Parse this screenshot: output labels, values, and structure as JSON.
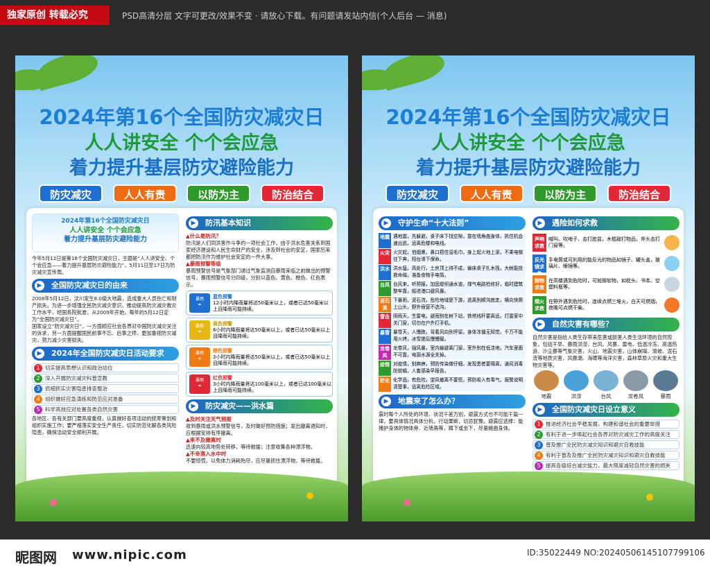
{
  "top": {
    "badge": "独家原创 转载必究",
    "note": "PSD高清分层 文字可更改/效果不变 · 请放心下载。有问题请发站内信(个人后台 — 消息)"
  },
  "bottom": {
    "logo": "昵图网",
    "url": "www.nipic.com",
    "id": "ID:35022449 NO:20240506145107799106"
  },
  "poster": {
    "title1": "2024年第16个全国防灾减灾日",
    "title2": "人人讲安全 个个会应急",
    "title3": "着力提升基层防灾避险能力",
    "tags": [
      "防灾减灾",
      "人人有责",
      "以防为主",
      "防治结合"
    ]
  },
  "left": {
    "banner": [
      "2024年第16个全国防灾减灾日",
      "人人讲安全 个个会应急",
      "着力提升基层防灾避险能力"
    ],
    "intro": "今年5月12日是第16个全国防灾减灾日，主题是“人人讲安全、个个会应急——着力提升基层防灾避险能力”，5月11日至17日为防灾减灾宣传周。",
    "sec1": "全国防灾减灾日的由来",
    "origin1": "2008年5月12日，汶川发生8.0级大地震，造成重大人员伤亡和财产损失。为进一步增强全民防灾减灾意识，推动提高防灾减灾救灾工作水平，经国务院批准，从2009年开始，每年的5月12日定为“全国防灾减灾日”。",
    "origin2": "国家设立“防灾减灾日”，一方面顺应社会各界对中国防灾减灾关注的诉求，另一方面提醒国民前事不忘、后事之师，更加重视防灾减灾，努力减少灾害损失。",
    "sec2": "2024年全国防灾减灾日活动要求",
    "reqs": [
      "切实提高思想认识和政治站位",
      "深入开展防灾减灾科普宣教",
      "抓细抓实灾害隐患排查整治",
      "组织做好应急演练和防范应对准备",
      "科学高效应对处置各类自然灾害"
    ],
    "closing": "各地区、各有关部门要高度重视，认真做好各项活动的统筹策划和组织实施工作；要严格落实安全生产责任，切实防范化解各类风险隐患，确保活动安全顺利开展。",
    "sec3": "防汛基本知识",
    "q1": "▲什么是防汛？",
    "a1": "防汛是人们同洪害作斗争的一项社会工作，由于洪水危害关系到国家经济建设和人民生命财产的安全，涉及到社会的安定，国家历来都把防汛作为维护社会安定的一件大事。",
    "q2": "▲暴雨预警等级",
    "a2": "暴雨预警信号是气象部门通过气象监测自暴雨来临之前做出的预警信号，暴雨预警信号分四级，分别以蓝色、黄色、橙色、红色表示。",
    "warnings": [
      {
        "name": "蓝色预警",
        "text": "12小时内降雨量将达50毫米以上，或者已达50毫米以上且降雨可能持续。",
        "color": "#1f6fd1"
      },
      {
        "name": "黄色预警",
        "text": "6小时内降雨量将达50毫米以上，或者已达50毫米以上且降雨可能持续。",
        "color": "#e8b714"
      },
      {
        "name": "橙色预警",
        "text": "3小时内降雨量将达50毫米以上，或者已达50毫米以上且降雨可能持续。",
        "color": "#ee7b14"
      },
      {
        "name": "红色预警",
        "text": "3小时内降雨量将达100毫米以上，或者已达100毫米以上且降雨可能持续。",
        "color": "#e02836"
      }
    ],
    "sec4": "防灾减灾——洪水篇",
    "q3": "▲及时关注天气预报",
    "a3": "收到暴雨或洪水预警信号，及时做好预防措施；发出撤离通知时，应根据安排有序撤离。",
    "q4": "▲来不及撤离时",
    "a4": "迅速向较高地势处转移，等待救援；注意收集各种漂浮物。",
    "q5": "▲不幸落入水中时",
    "a5": "不要惊慌，以免体力消耗殆尽，应尽量抓住漂浮物，等待救援。"
  },
  "right": {
    "sec1": "守护生命“十大法则”",
    "laws": [
      {
        "tag": "地震",
        "text": "遇地震，先躲避，桌子床下找空隙，靠在墙角曲身体，抓住机会速出逃，远离危楼和电线。"
      },
      {
        "tag": "火灾",
        "text": "火灾起，怕烟熏，鼻口捂住湿毛巾，身上起火地上滚，不乘电梯往下奔，阳台滑下保命。"
      },
      {
        "tag": "洪水",
        "text": "洪水猛，高处行，土房顶上待不成，躲床桌子扎木筏，大树能拴救命绳，准备食物手电筒。"
      },
      {
        "tag": "台风",
        "text": "台风来，听预报，加固堤坝通水道，煤气电路检修好，临时建筑整牢靠，船进港口避风暴。"
      },
      {
        "tag": "泥石流",
        "text": "下暴雨，泥石流，危险地域是下游，逃离别顺沟底走，横向快爬上山头，野外宿营不选沟。"
      },
      {
        "tag": "雷击",
        "text": "阴雨天，生雷电，避雨别在树下站，铁塔线杆要离远，打雷家中关门窗，切勿在户外打手机。"
      },
      {
        "tag": "暴雪",
        "text": "暴雪天，人慢跑，背着风向别停留，身体冻僵无知觉，千万不能用火烤，冰雪搓后慢慢暖。"
      },
      {
        "tag": "龙卷风",
        "text": "龙卷风，强风暴，室内躲避离门窗，室外别在低洼地，汽车里面不可靠，电源水源全关掉。"
      },
      {
        "tag": "疫情",
        "text": "对疫情，别麻痹，预防传染做仔细，发现患者要隔离，通风消毒防蚊蝇，人畜感染早报告。"
      },
      {
        "tag": "防化",
        "text": "化学品，有危险，逆风撤离不要慌，预防吸入有毒气，报警说明清楚事，远离危险区域。"
      }
    ],
    "sec2": "地震来了怎么办？",
    "quake": "震时每个人所处的环境、状况千差万别，避震方式也不可能千篇一律，要具体情况具体分析。行动果断，切忌犹豫。避震应选择：能掩护身体的物体旁、近墙角等，蹲下或坐下，尽量蜷曲身体。",
    "sec3": "遇险如何求救",
    "rescues": [
      {
        "tag": "声响求救",
        "text": "喊叫、吹哨子、击打脸盆，木棍敲打物品，斧头击打门窗等。"
      },
      {
        "tag": "反光镜求救",
        "text": "手电筒或可利用的能反光的物品如镜子、罐头盖，玻璃片、眼镜等。"
      },
      {
        "tag": "抛物求救",
        "text": "在高楼遇到危险时，可抛掷软物，如枕头、书本、空塑料瓶等。"
      },
      {
        "tag": "烟火求救",
        "text": "在野外遇到危险时，连续点燃三堆火，白天可燃烟，夜晚可点燃干柴。"
      }
    ],
    "sec4": "自然灾害有哪些？",
    "natural": "自然灾害是指给人类生存带来危害或损害人类生活环境的自然现象，包括干旱、暴雨洪涝、台风、风暴、雷电、低温冷冻、高温热浪、沙尘暴等气象灾害，火山、地震灾害，山体崩塌、滑坡、泥石流等地质灾害，风暴潮、海啸等海洋灾害，森林草原火灾和重大生物灾害等。",
    "disasters": [
      "地震",
      "洪涝",
      "台风",
      "龙卷风",
      "暴雨"
    ],
    "sec5": "全国防灾减灾日设立意义",
    "meanings": [
      "推进经济社会平稳发展，构建和谐社会的重要举措",
      "有利于进一步唤起社会各界对防灾减灾工作的高度关注",
      "普及推广全民防灾减灾知识和避灾自救技能",
      "有利于普及及推广全民防灾减灾知识和避灾自救技能",
      "提高各级综合减灾能力，最大限度减轻自然灾害的损失"
    ]
  }
}
